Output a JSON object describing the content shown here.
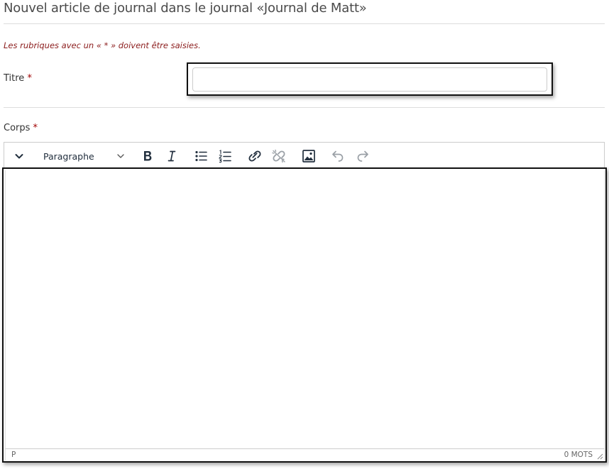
{
  "page": {
    "title": "Nouvel article de journal dans le journal «Journal de Matt»",
    "required_note": "Les rubriques avec un « * » doivent être saisies."
  },
  "form": {
    "titre": {
      "label": "Titre",
      "required_marker": "*",
      "value": ""
    },
    "corps": {
      "label": "Corps",
      "required_marker": "*"
    }
  },
  "editor": {
    "toolbar": {
      "toggle_icon": "chevron-down-icon",
      "block_format": "Paragraphe",
      "buttons": [
        "bold-icon",
        "italic-icon",
        "bullet-list-icon",
        "numbered-list-icon",
        "link-icon",
        "unlink-icon",
        "image-icon",
        "undo-icon",
        "redo-icon"
      ]
    },
    "statusbar": {
      "path": "P",
      "word_count": "0 MOTS"
    }
  },
  "colors": {
    "required": "#a00000",
    "note": "#8b1c1c",
    "icon": "#222f3e",
    "disabled_icon": "#9aa0a6"
  }
}
